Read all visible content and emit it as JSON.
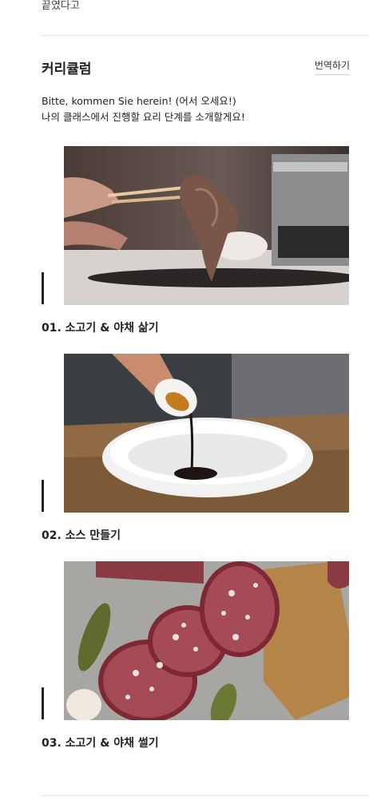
{
  "previous_section": {
    "tail_text": "끝였다고"
  },
  "curriculum": {
    "title": "커리큘럼",
    "translate_label": "번역하기",
    "intro_lines": [
      "Bitte, kommen Sie herein! (어서 오세요!)",
      "나의 클래스에서 진행할 요리 단계를 소개할게요!"
    ],
    "steps": [
      {
        "caption": "01. 소고기 & 야채 삶기",
        "image": "chopsticks-holding-cooked-beef"
      },
      {
        "caption": "02. 소스 만들기",
        "image": "pouring-sauce-into-white-bowl"
      },
      {
        "caption": "03. 소고기 & 야채 썰기",
        "image": "sliced-salami-with-pickles"
      }
    ]
  }
}
